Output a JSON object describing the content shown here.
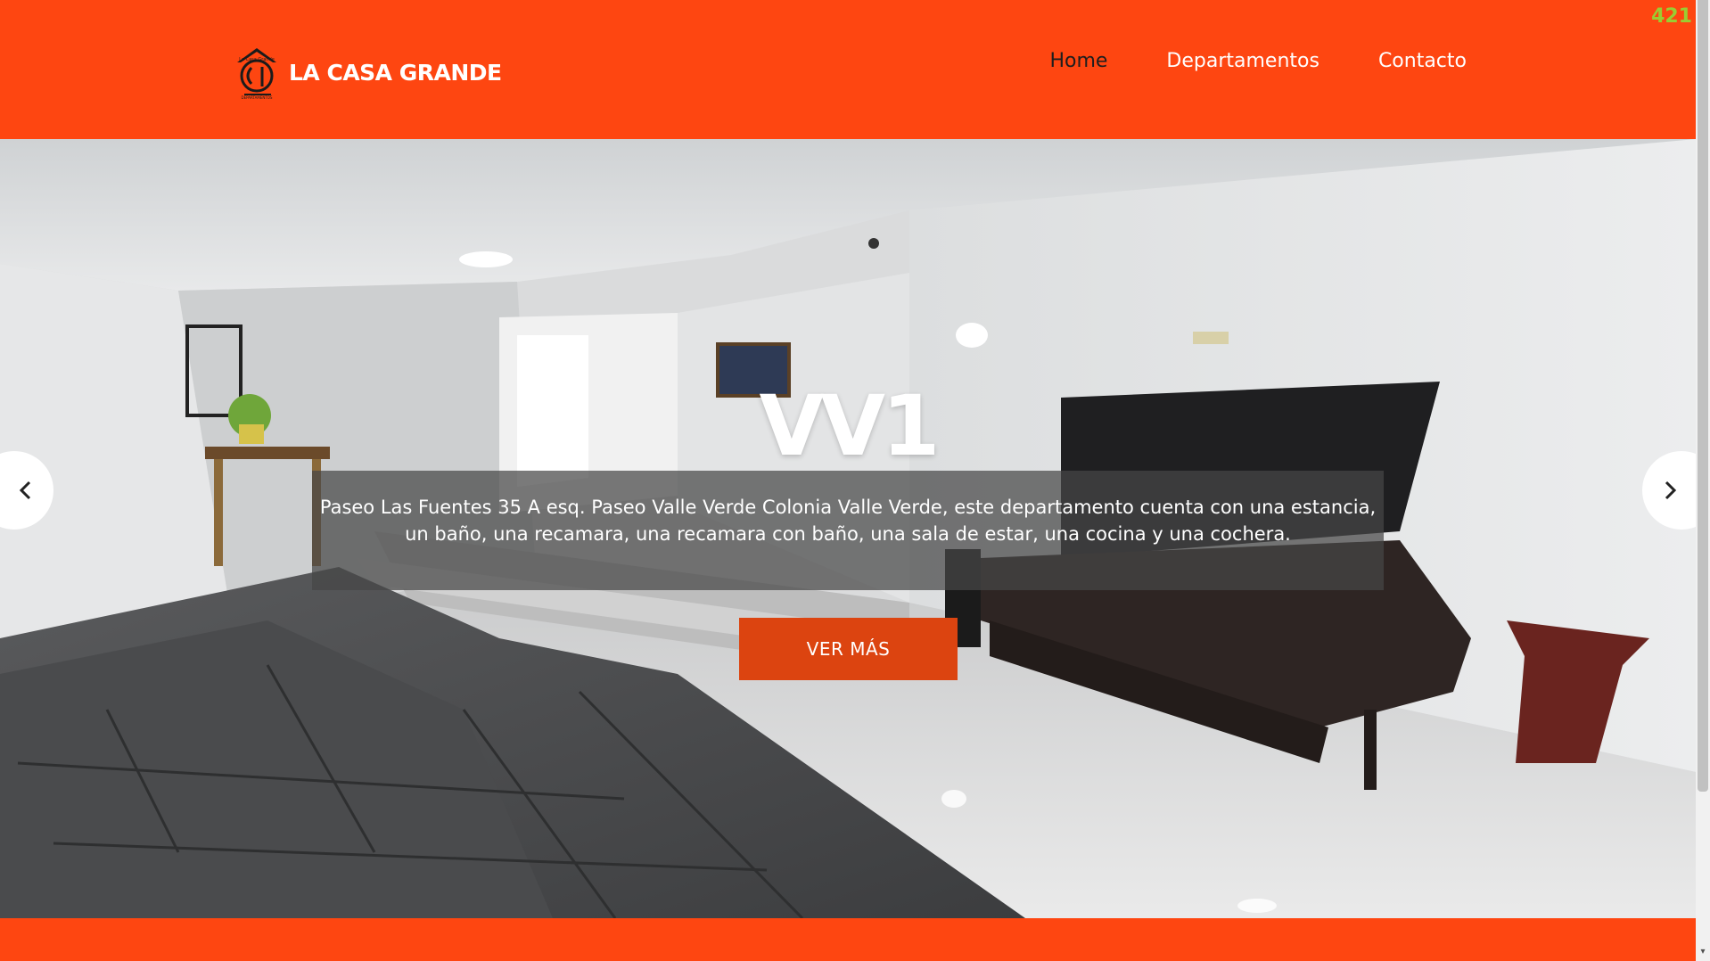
{
  "brand": {
    "name": "LA CASA GRANDE",
    "logo_icon": "house-logo-icon",
    "logo_text_top": "La Casa Grande",
    "logo_text_bottom": "DEPARTAMENTOS",
    "logo_monogram": "CG"
  },
  "nav": {
    "items": [
      {
        "label": "Home",
        "active": true
      },
      {
        "label": "Departamentos",
        "active": false
      },
      {
        "label": "Contacto",
        "active": false
      }
    ]
  },
  "counter": "421",
  "slide": {
    "title": "VV1",
    "description": "Paseo Las Fuentes 35 A esq. Paseo Valle Verde Colonia Valle Verde, este departamento cuenta con una estancia, un baño, una recamara, una recamara con baño, una sala de estar, una cocina y una cochera.",
    "cta_label": "VER MÁS",
    "prev_icon": "chevron-left-icon",
    "next_icon": "chevron-right-icon"
  },
  "colors": {
    "brand_orange": "#fe4611",
    "button_orange": "#dc4410",
    "counter_green": "#9acd32"
  }
}
